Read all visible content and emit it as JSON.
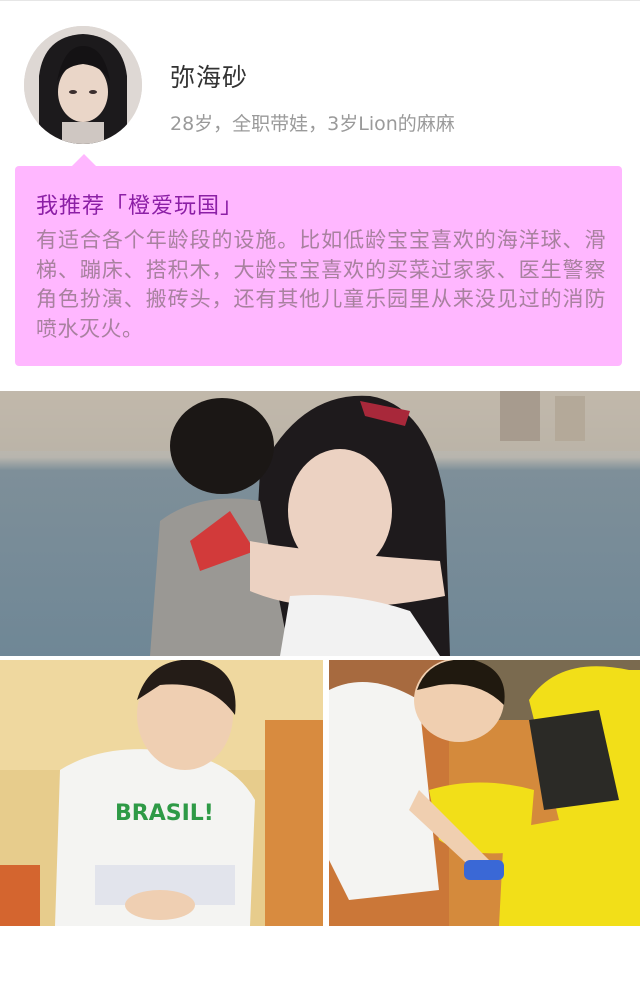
{
  "profile": {
    "avatar_icon": "avatar-photo",
    "name": "弥海砂",
    "description": "28岁，全职带娃，3岁Lion的麻麻"
  },
  "recommendation": {
    "title": "我推荐「橙爱玩国」",
    "body": "有适合各个年龄段的设施。比如低龄宝宝喜欢的海洋球、滑梯、蹦床、搭积木，大龄宝宝喜欢的买菜过家家、医生警察角色扮演、搬砖头，还有其他儿童乐园里从来没见过的消防喷水灭火。",
    "background_color": "#ffb7ff",
    "title_color": "#8c1fa6",
    "body_color": "#a8819f"
  },
  "photos": {
    "main": {
      "icon": "mother-hugging-child-photo"
    },
    "left": {
      "icon": "boy-brasil-shirt-photo",
      "shirt_text": "BRASIL!"
    },
    "right": {
      "icon": "boy-with-yellow-toy-car-photo"
    }
  }
}
